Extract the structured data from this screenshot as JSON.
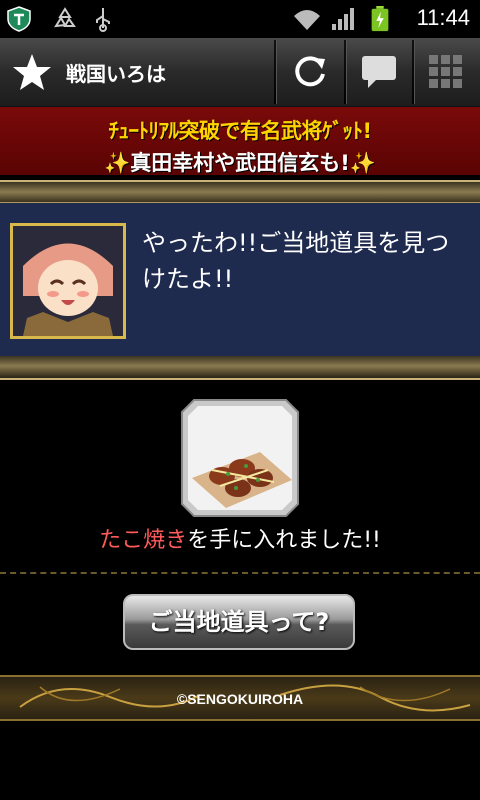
{
  "status_bar": {
    "time": "11:44",
    "icons": [
      "shield-app-icon",
      "recycle-icon",
      "usb-icon",
      "wifi-icon",
      "signal-icon",
      "battery-charging-icon"
    ]
  },
  "app_bar": {
    "title": "戦国いろは",
    "icons": [
      "star-icon",
      "refresh-icon",
      "chat-icon",
      "grid-menu-icon"
    ]
  },
  "banner": {
    "line1": "ﾁｭｰﾄﾘｱﾙ突破で有名武将ｹﾞｯﾄ!",
    "line2": "真田幸村や武田信玄も!",
    "sparkle": "✨"
  },
  "dialog": {
    "message": "やったわ!!ご当地道具を見つけたよ!!"
  },
  "reward": {
    "item_name": "たこ焼き",
    "suffix": "を手に入れました!!"
  },
  "help_button": {
    "label": "ご当地道具って?"
  },
  "footer": {
    "copyright": "©SENGOKUIROHA"
  },
  "colors": {
    "banner_bg": "#6a0606",
    "banner_line1": "#ffd400",
    "panel_bg": "#1e2a4e",
    "item_name": "#ff5a5a",
    "frame_gold": "#c8b27a"
  }
}
